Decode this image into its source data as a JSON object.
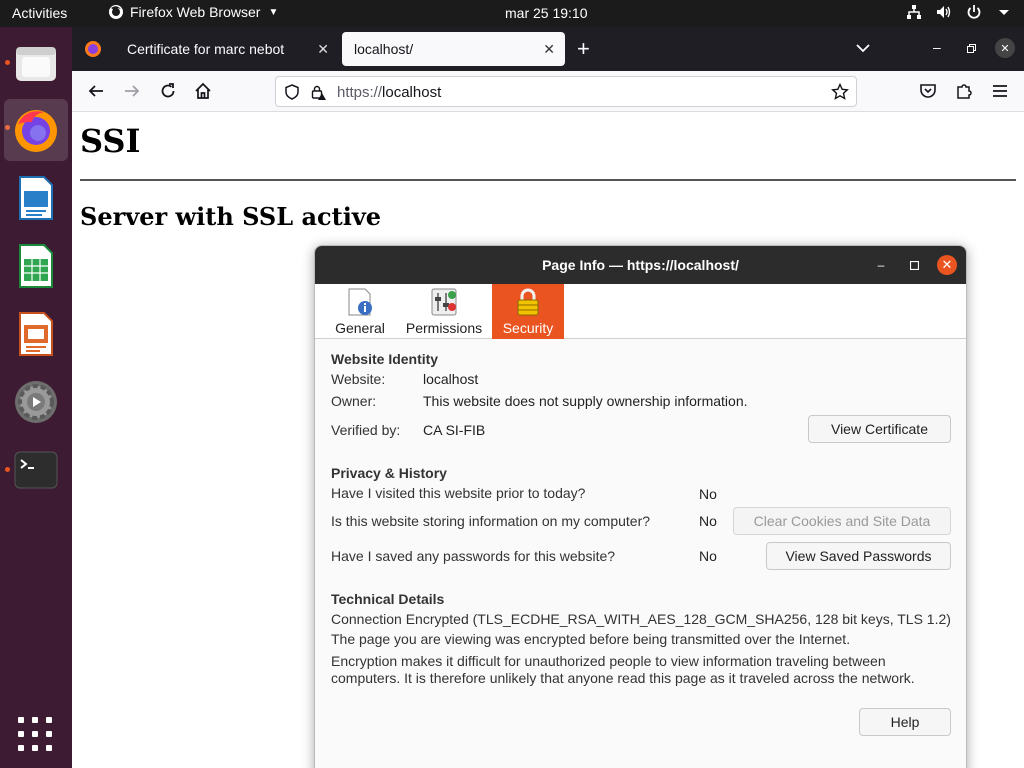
{
  "topbar": {
    "activities": "Activities",
    "app_name": "Firefox Web Browser",
    "clock": "mar 25  19:10",
    "status_icons": [
      "network-icon",
      "volume-icon",
      "power-icon",
      "chevron-down-icon"
    ]
  },
  "dock": {
    "items": [
      "files-icon",
      "firefox-icon",
      "writer-icon",
      "calc-icon",
      "impress-icon",
      "settings-icon",
      "terminal-icon"
    ],
    "apps_grid": "show-apps-icon"
  },
  "browser": {
    "tabs": [
      {
        "label": "Certificate for marc nebot",
        "selected": false
      },
      {
        "label": "localhost/",
        "selected": true
      }
    ],
    "new_tab": "+",
    "url_protocol": "https://",
    "url_host": "localhost",
    "accent": "#e95420"
  },
  "page": {
    "h1": "SSI",
    "h2": "Server with SSL active"
  },
  "dialog": {
    "title": "Page Info — https://localhost/",
    "tabs": {
      "general": "General",
      "permissions": "Permissions",
      "security": "Security"
    },
    "identity": {
      "heading": "Website Identity",
      "website_label": "Website:",
      "website_value": "localhost",
      "owner_label": "Owner:",
      "owner_value": "This website does not supply ownership information.",
      "verified_label": "Verified by:",
      "verified_value": "CA SI-FIB",
      "view_certificate": "View Certificate"
    },
    "privacy": {
      "heading": "Privacy & History",
      "q1": "Have I visited this website prior to today?",
      "a1": "No",
      "q2": "Is this website storing information on my computer?",
      "a2": "No",
      "clear_cookies": "Clear Cookies and Site Data",
      "q3": "Have I saved any passwords for this website?",
      "a3": "No",
      "view_passwords": "View Saved Passwords"
    },
    "technical": {
      "heading": "Technical Details",
      "line1": "Connection Encrypted (TLS_ECDHE_RSA_WITH_AES_128_GCM_SHA256, 128 bit keys, TLS 1.2)",
      "line2": "The page you are viewing was encrypted before being transmitted over the Internet.",
      "line3": "Encryption makes it difficult for unauthorized people to view information traveling between computers. It is therefore unlikely that anyone read this page as it traveled across the network."
    },
    "help": "Help"
  }
}
